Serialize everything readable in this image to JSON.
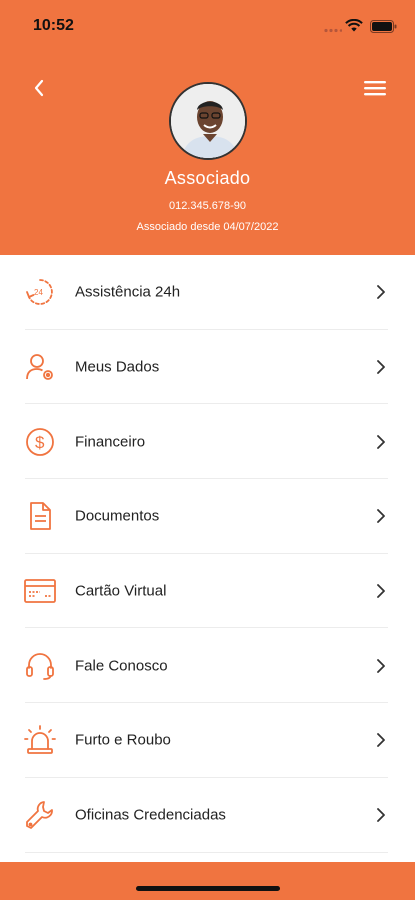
{
  "status_bar": {
    "time": "10:52"
  },
  "profile": {
    "name": "Associado",
    "document": "012.345.678-90",
    "member_since": "Associado desde 04/07/2022"
  },
  "menu": {
    "items": [
      {
        "label": "Assistência 24h",
        "icon": "assistance-24h-icon"
      },
      {
        "label": "Meus Dados",
        "icon": "user-settings-icon"
      },
      {
        "label": "Financeiro",
        "icon": "dollar-circle-icon"
      },
      {
        "label": "Documentos",
        "icon": "document-icon"
      },
      {
        "label": "Cartão Virtual",
        "icon": "card-icon"
      },
      {
        "label": "Fale Conosco",
        "icon": "headset-icon"
      },
      {
        "label": "Furto e Roubo",
        "icon": "siren-icon"
      },
      {
        "label": "Oficinas Credenciadas",
        "icon": "wrench-icon"
      }
    ]
  },
  "colors": {
    "accent": "#f07440",
    "text": "#222222",
    "divider": "#ececec"
  }
}
